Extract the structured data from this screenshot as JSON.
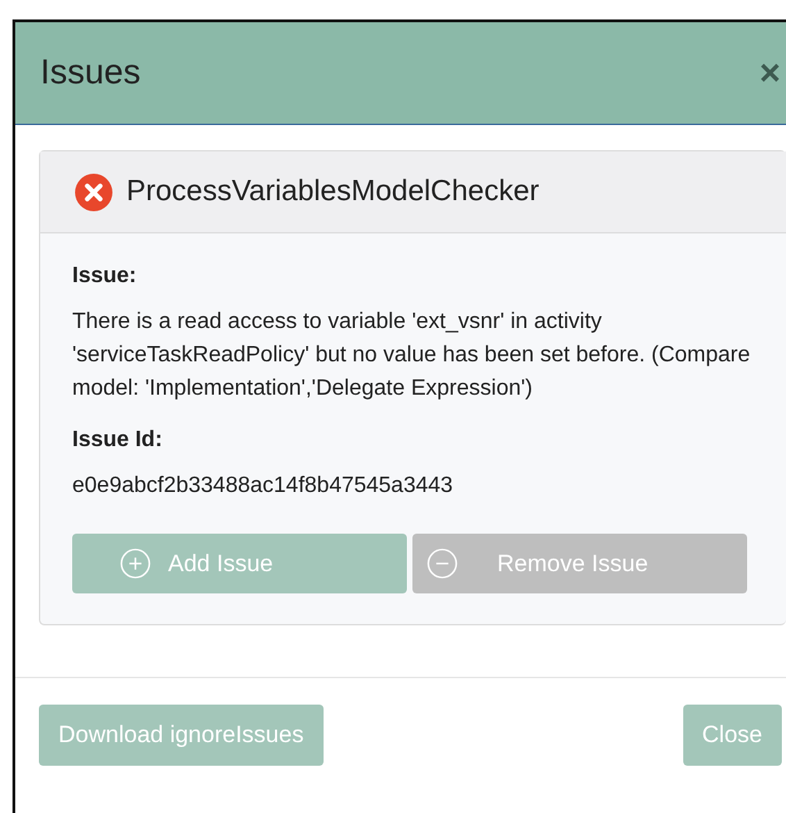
{
  "dialog": {
    "title": "Issues",
    "close_glyph": "×"
  },
  "issue_card": {
    "checker": "ProcessVariablesModelChecker",
    "fields": [
      {
        "label": "Issue:",
        "value": "There is a read access to variable 'ext_vsnr' in activity 'serviceTaskReadPolicy' but no value has been set before. (Compare model: 'Implementation','Delegate Expression')"
      },
      {
        "label": "Issue Id:",
        "value": "e0e9abcf2b33488ac14f8b47545a3443"
      }
    ],
    "actions": [
      {
        "label": "Add Issue",
        "kind": "add",
        "disabled": false
      },
      {
        "label": "Remove Issue",
        "kind": "remove",
        "disabled": true
      }
    ]
  },
  "footer": {
    "buttons": [
      "Download ignoreIssues",
      "Close"
    ]
  }
}
